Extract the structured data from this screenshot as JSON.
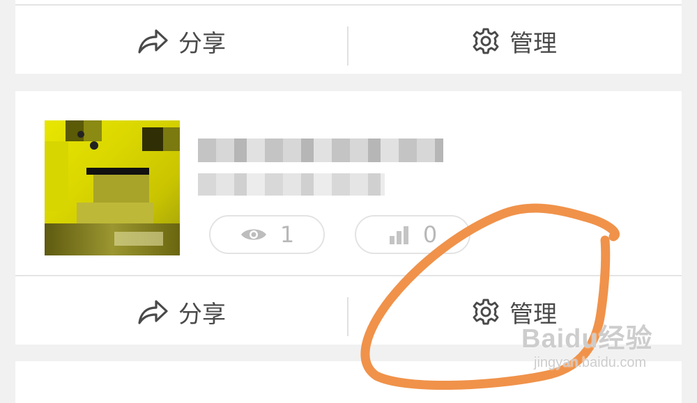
{
  "top_card": {
    "share_label": "分享",
    "manage_label": "管理"
  },
  "item": {
    "views_count": "1",
    "stats_count": "0",
    "share_label": "分享",
    "manage_label": "管理"
  },
  "annotation": {
    "stroke_color": "#f0924a"
  },
  "watermark": {
    "brand": "Baidu经验",
    "domain": "jingyan.baidu.com"
  },
  "colors": {
    "background": "#f1f1f1",
    "card": "#ffffff",
    "text": "#4a4a4a",
    "muted": "#b8b8b8"
  }
}
